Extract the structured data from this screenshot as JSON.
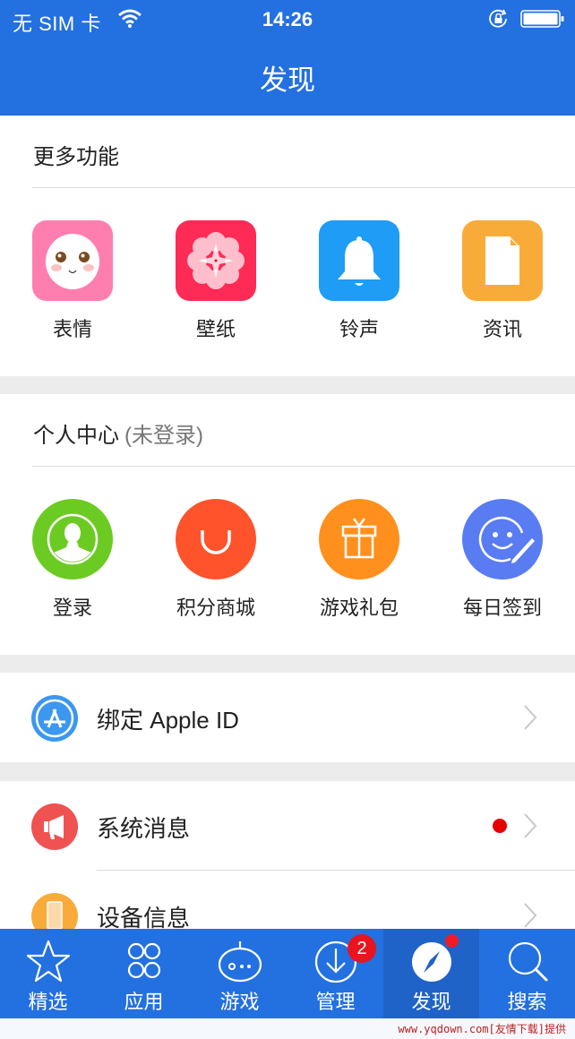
{
  "status_bar": {
    "carrier": "无 SIM 卡",
    "time": "14:26",
    "icons": [
      "wifi-icon",
      "orientation-lock-icon",
      "battery-icon"
    ]
  },
  "nav": {
    "title": "发现"
  },
  "more_features": {
    "title": "更多功能",
    "items": [
      {
        "label": "表情",
        "icon": "emoji-face-icon",
        "color": "#ff7eb0"
      },
      {
        "label": "壁纸",
        "icon": "flower-wallpaper-icon",
        "color": "#fd2b55"
      },
      {
        "label": "铃声",
        "icon": "bell-icon",
        "color": "#1f9cf5"
      },
      {
        "label": "资讯",
        "icon": "document-icon",
        "color": "#f9ab39"
      }
    ]
  },
  "personal_center": {
    "title": "个人中心",
    "subtitle": "(未登录)",
    "items": [
      {
        "label": "登录",
        "icon": "user-login-icon",
        "color": "#6ccb23"
      },
      {
        "label": "积分商城",
        "icon": "shop-bag-icon",
        "color": "#ff532c"
      },
      {
        "label": "游戏礼包",
        "icon": "gift-icon",
        "color": "#ff901d"
      },
      {
        "label": "每日签到",
        "icon": "smile-sign-icon",
        "color": "#597cf3"
      }
    ]
  },
  "list": {
    "apple_id": {
      "label": "绑定 Apple ID",
      "icon": "app-store-icon",
      "color": "#3c97ee"
    },
    "system_messages": {
      "label": "系统消息",
      "icon": "megaphone-icon",
      "color": "#f05151",
      "unread": true
    },
    "device_info": {
      "label": "设备信息",
      "icon": "phone-device-icon",
      "color": "#f9ab39"
    }
  },
  "tabbar": {
    "tabs": [
      {
        "label": "精选",
        "icon": "star-icon"
      },
      {
        "label": "应用",
        "icon": "apps-grid-icon"
      },
      {
        "label": "游戏",
        "icon": "game-robot-icon"
      },
      {
        "label": "管理",
        "icon": "download-icon",
        "badge": "2"
      },
      {
        "label": "发现",
        "icon": "compass-icon",
        "active": true,
        "dot": true
      },
      {
        "label": "搜索",
        "icon": "search-icon"
      }
    ]
  },
  "watermark": "www.yqdown.com[友情下载]提供"
}
